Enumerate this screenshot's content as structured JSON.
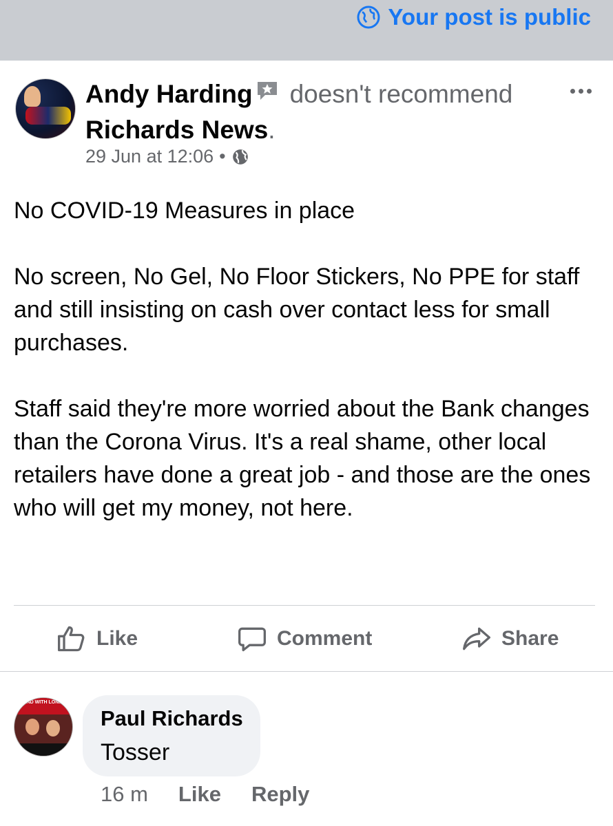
{
  "notice": {
    "text": "Your post is public",
    "icon": "globe-icon",
    "color": "#1877f2"
  },
  "post": {
    "author": "Andy Harding",
    "verb": "doesn't recommend",
    "page": "Richards News",
    "timestamp": "29 Jun at 12:06",
    "separator": "•",
    "audience_icon": "globe-icon",
    "paragraphs": [
      "No COVID-19 Measures in place",
      "No screen, No Gel, No Floor Stickers, No PPE for staff and still insisting on cash over contact less for small purchases.",
      "Staff said they're more worried about the Bank changes than the Corona Virus. It's a real shame, other local retailers have done a great job - and those are the ones who will get my money, not here."
    ]
  },
  "actions": {
    "like": "Like",
    "comment": "Comment",
    "share": "Share"
  },
  "comment": {
    "author": "Paul Richards",
    "text": "Tosser",
    "time": "16 m",
    "like": "Like",
    "reply": "Reply",
    "avatar_banner": "STAND WITH LONDON"
  },
  "colors": {
    "accent": "#1877f2",
    "muted": "#65676b",
    "topbar": "#c9ccd1",
    "bubble": "#f0f2f5"
  }
}
